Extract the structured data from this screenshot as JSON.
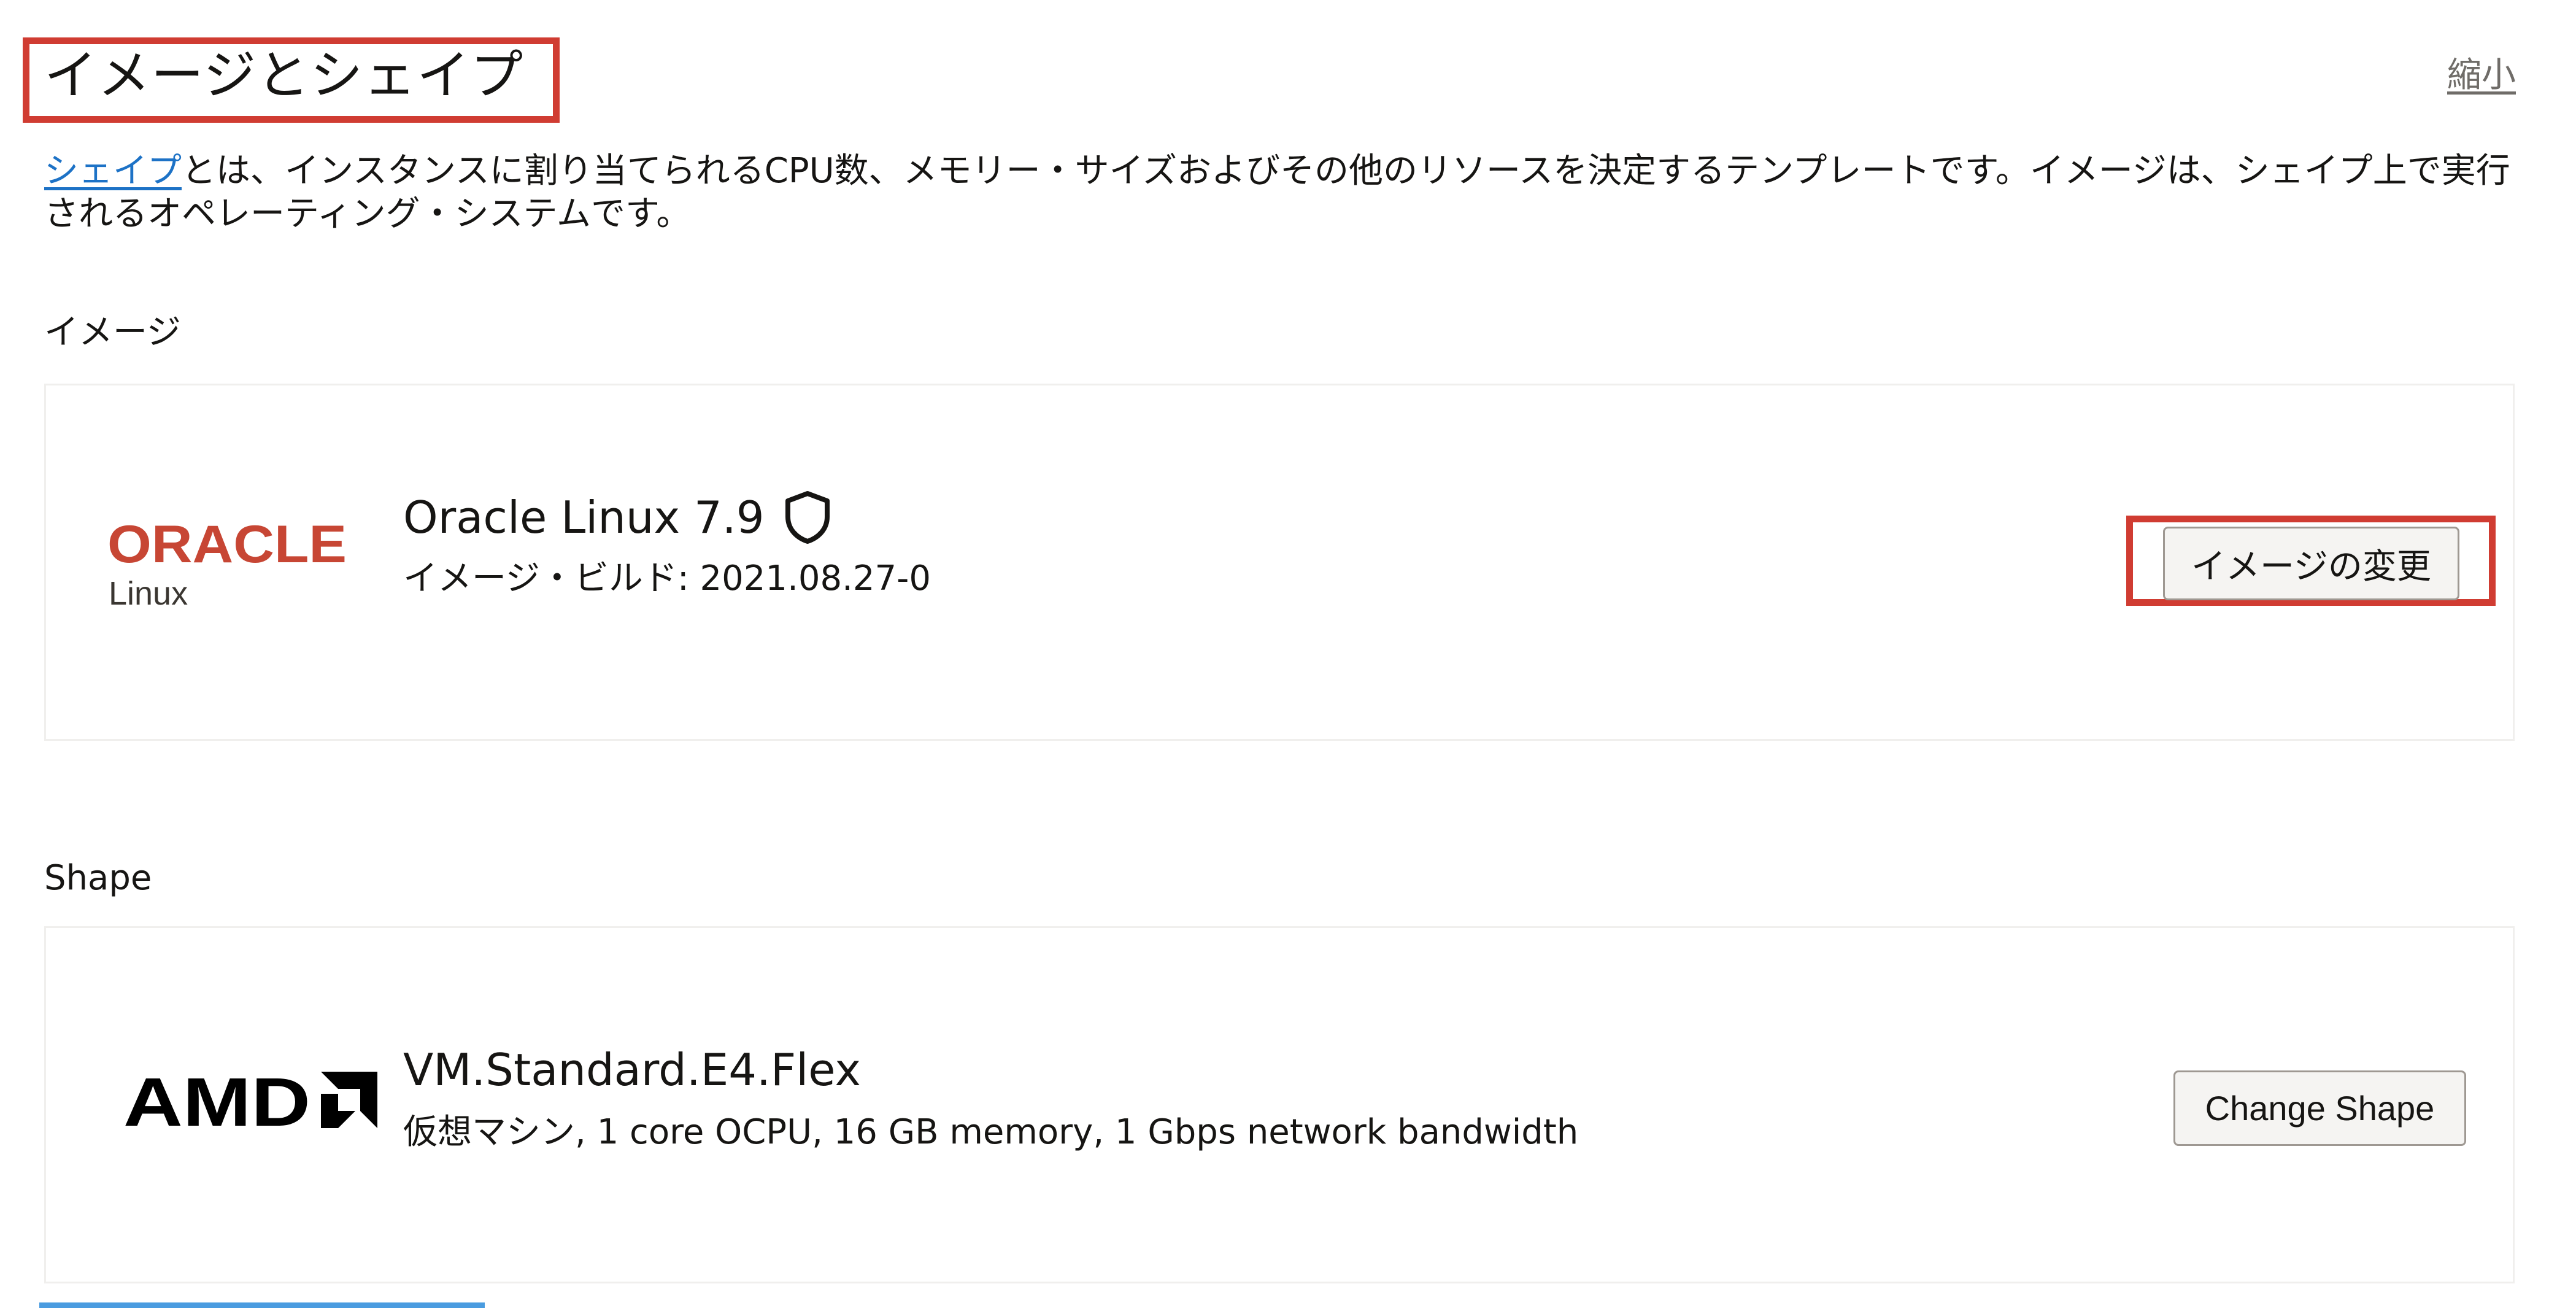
{
  "section": {
    "title": "イメージとシェイプ",
    "collapse_label": "縮小"
  },
  "description": {
    "link_text": "シェイプ",
    "text": "とは、インスタンスに割り当てられるCPU数、メモリー・サイズおよびその他のリソースを決定するテンプレートです。イメージは、シェイプ上で実行されるオペレーティング・システムです。"
  },
  "image_section": {
    "label": "イメージ",
    "logo_text": "ORACLE",
    "logo_subtext": "Linux",
    "title": "Oracle Linux 7.9",
    "icon": "shield-icon",
    "build_text": "イメージ・ビルド: 2021.08.27-0",
    "change_button_label": "イメージの変更"
  },
  "shape_section": {
    "label": "Shape",
    "logo_text": "AMD",
    "title": "VM.Standard.E4.Flex",
    "details": "仮想マシン, 1 core OCPU, 16 GB memory, 1 Gbps network bandwidth",
    "change_button_label": "Change Shape"
  },
  "colors": {
    "accent_red": "#d03c32",
    "link_blue": "#1d72c6",
    "oracle_red": "#c74634"
  }
}
